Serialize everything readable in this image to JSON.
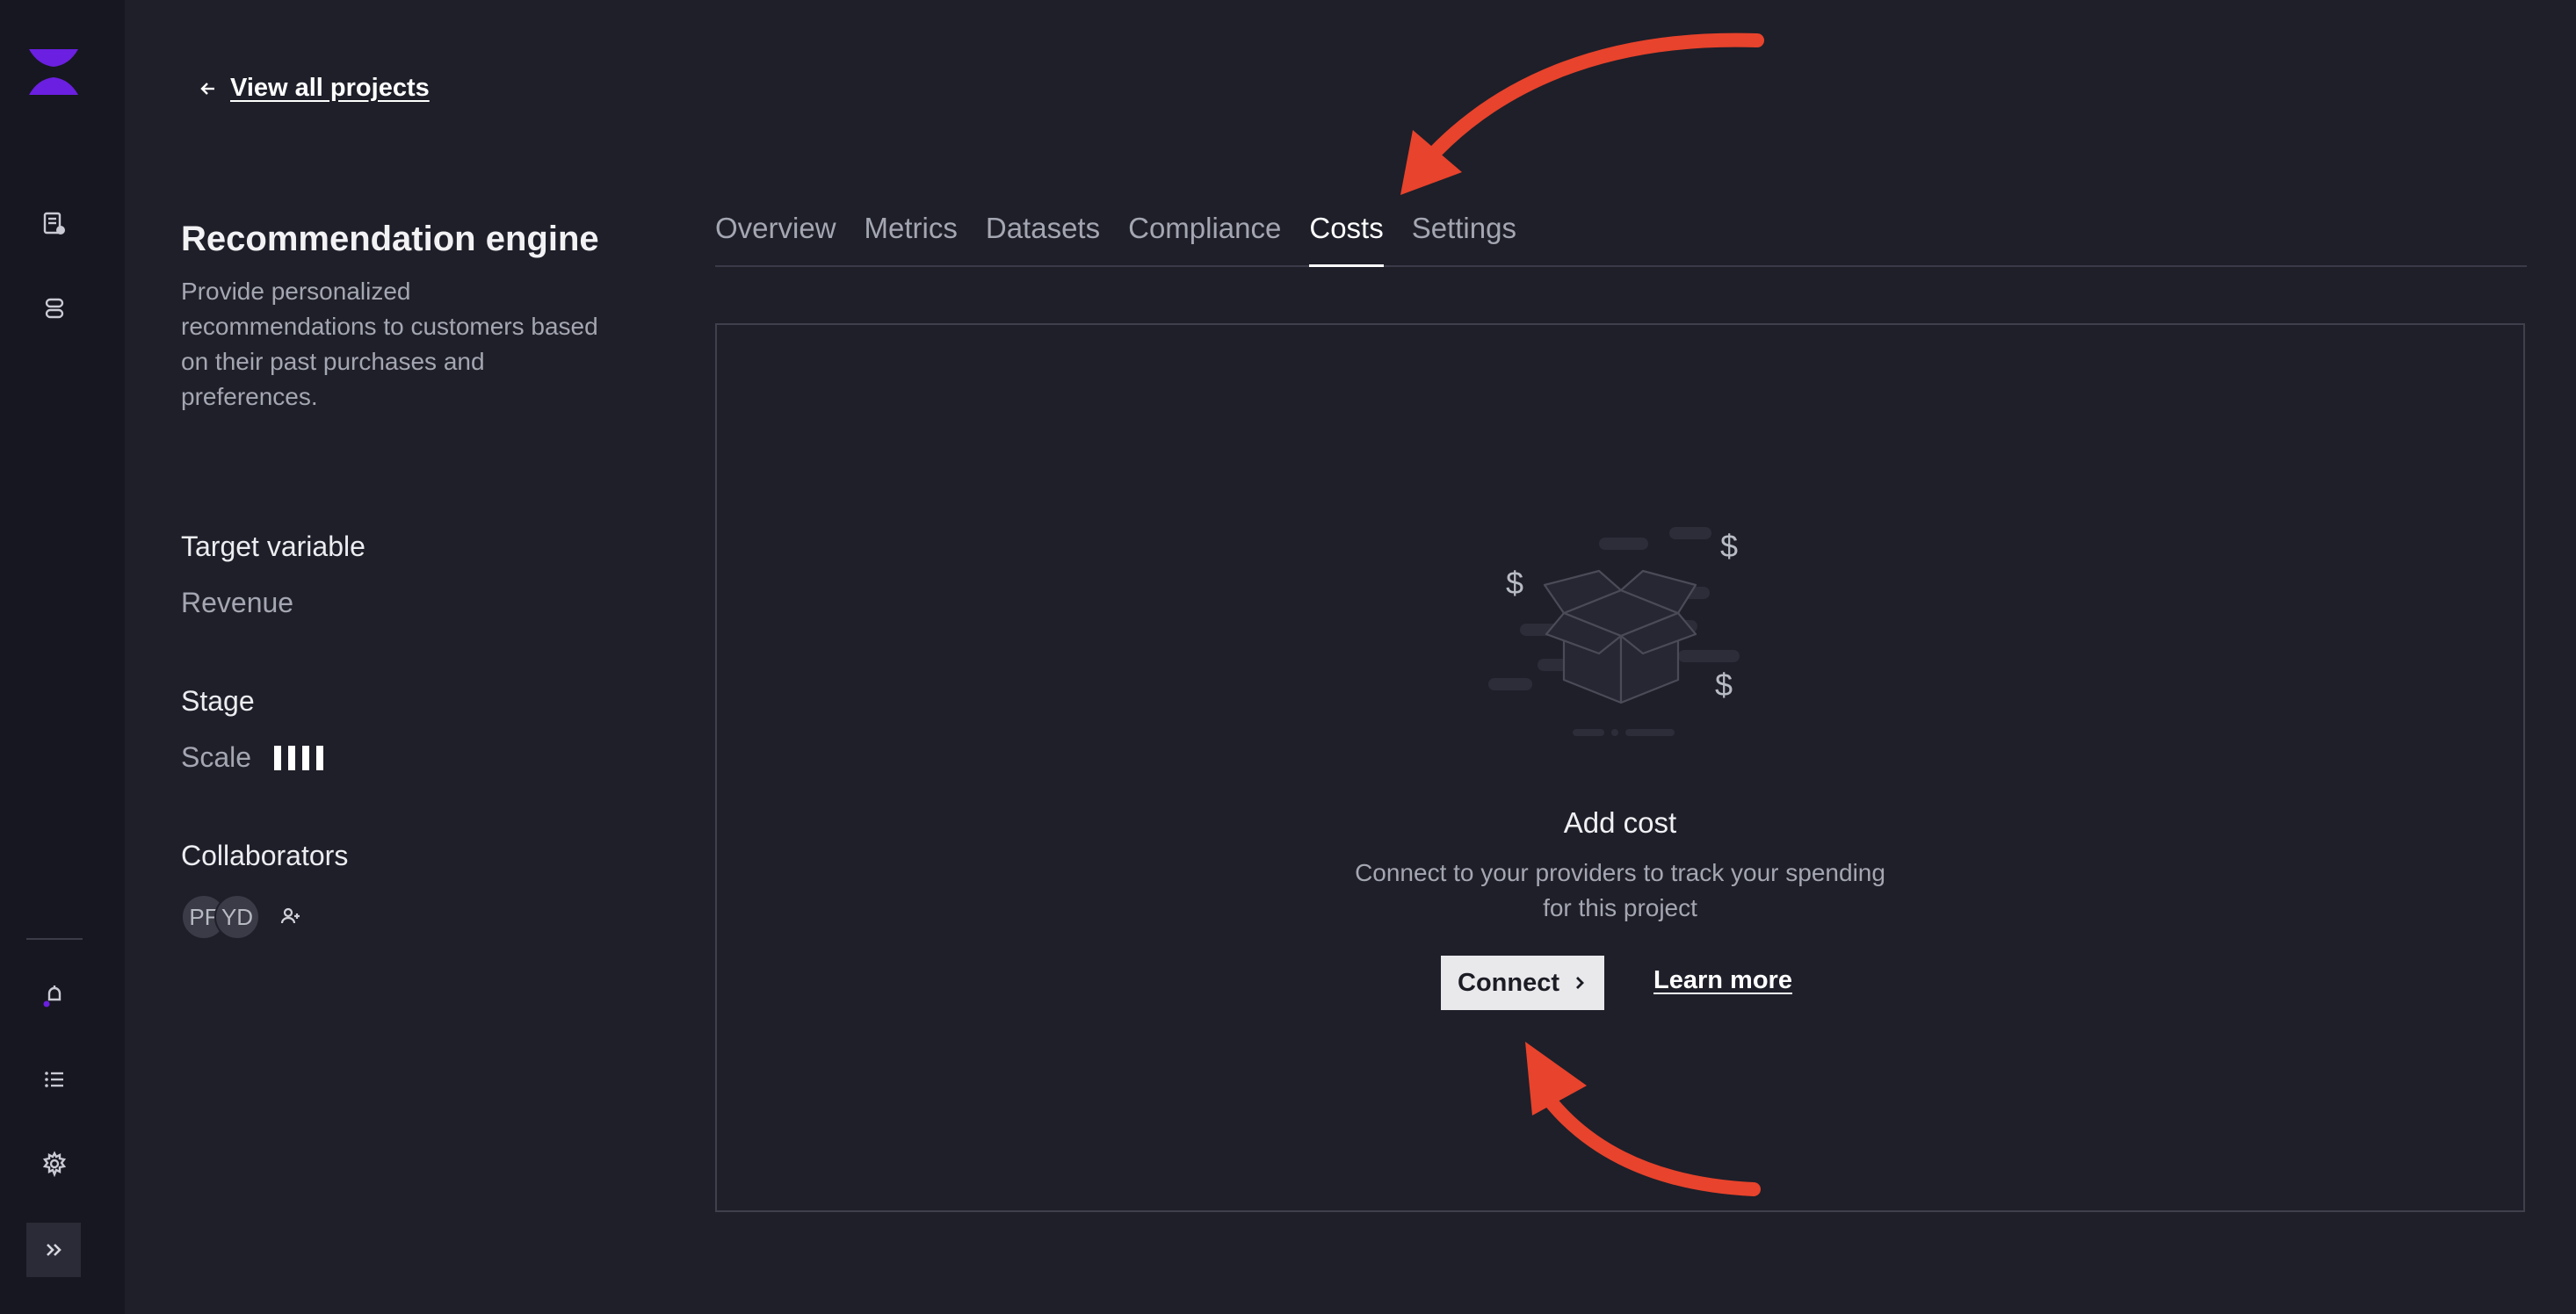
{
  "nav": {
    "back_link": "View all projects",
    "rail_icons": [
      "logo-icon",
      "projects-icon",
      "datasets-icon",
      "notifications-icon",
      "list-icon",
      "settings-icon",
      "expand-icon"
    ]
  },
  "project": {
    "title": "Recommendation engine",
    "description": "Provide personalized recommendations to customers based on their past purchases and preferences.",
    "target_label": "Target variable",
    "target_value": "Revenue",
    "stage_label": "Stage",
    "stage_value": "Scale",
    "stage_level": 4,
    "collaborators_label": "Collaborators",
    "collaborators": [
      "PF",
      "YD"
    ]
  },
  "tabs": [
    {
      "label": "Overview",
      "active": false
    },
    {
      "label": "Metrics",
      "active": false
    },
    {
      "label": "Datasets",
      "active": false
    },
    {
      "label": "Compliance",
      "active": false
    },
    {
      "label": "Costs",
      "active": true
    },
    {
      "label": "Settings",
      "active": false
    }
  ],
  "empty_state": {
    "title": "Add cost",
    "description": "Connect to your providers to track your spending for this project",
    "connect_label": "Connect",
    "learn_more_label": "Learn more",
    "dollar_symbol": "$"
  },
  "colors": {
    "background": "#1e1f29",
    "rail": "#161720",
    "brand": "#6b1fe0",
    "annotation": "#e8432c"
  }
}
